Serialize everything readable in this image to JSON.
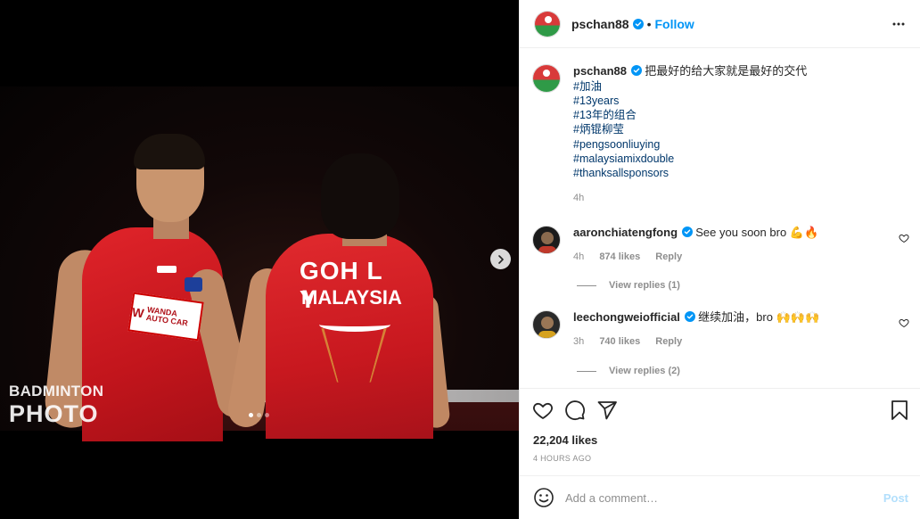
{
  "post": {
    "username": "pschan88",
    "follow_label": "Follow",
    "separator": "•",
    "caption_text": "把最好的给大家就是最好的交代",
    "hashtags": [
      "#加油",
      "#13years",
      "#13年的组合",
      "#炳锟柳莹",
      "#pengsoonliuying",
      "#malaysiamixdouble",
      "#thanksallsponsors"
    ],
    "caption_age": "4h",
    "likes": "22,204 likes",
    "timestamp": "4 HOURS AGO"
  },
  "media": {
    "watermark_line1": "BADMINTON",
    "watermark_line2": "PHOTO",
    "jersey_name": "GOH L Y",
    "jersey_country": "MALAYSIA",
    "sponsor_mark": "W",
    "sponsor_text": "WANDA AUTO CAR",
    "carousel_dots": 3,
    "active_dot": 1
  },
  "comments": [
    {
      "username": "aaronchiatengfong",
      "text": "See you soon bro 💪🔥",
      "age": "4h",
      "likes": "874 likes",
      "reply_label": "Reply",
      "view_replies": "View replies (1)"
    },
    {
      "username": "leechongweiofficial",
      "text": "继续加油，bro 🙌🙌🙌",
      "age": "3h",
      "likes": "740 likes",
      "reply_label": "Reply",
      "view_replies": "View replies (2)"
    }
  ],
  "add_comment": {
    "placeholder": "Add a comment…",
    "post_label": "Post"
  },
  "colors": {
    "accent": "#0095f6",
    "link_tag": "#00376b",
    "muted": "#8e8e8e",
    "post_disabled": "#b2dffc"
  },
  "icons": {
    "verified": "verified-badge-icon",
    "more": "more-options-icon",
    "like": "heart-icon",
    "comment": "comment-icon",
    "share": "share-icon",
    "save": "bookmark-icon",
    "emoji": "smiley-icon",
    "next": "chevron-right-icon"
  }
}
